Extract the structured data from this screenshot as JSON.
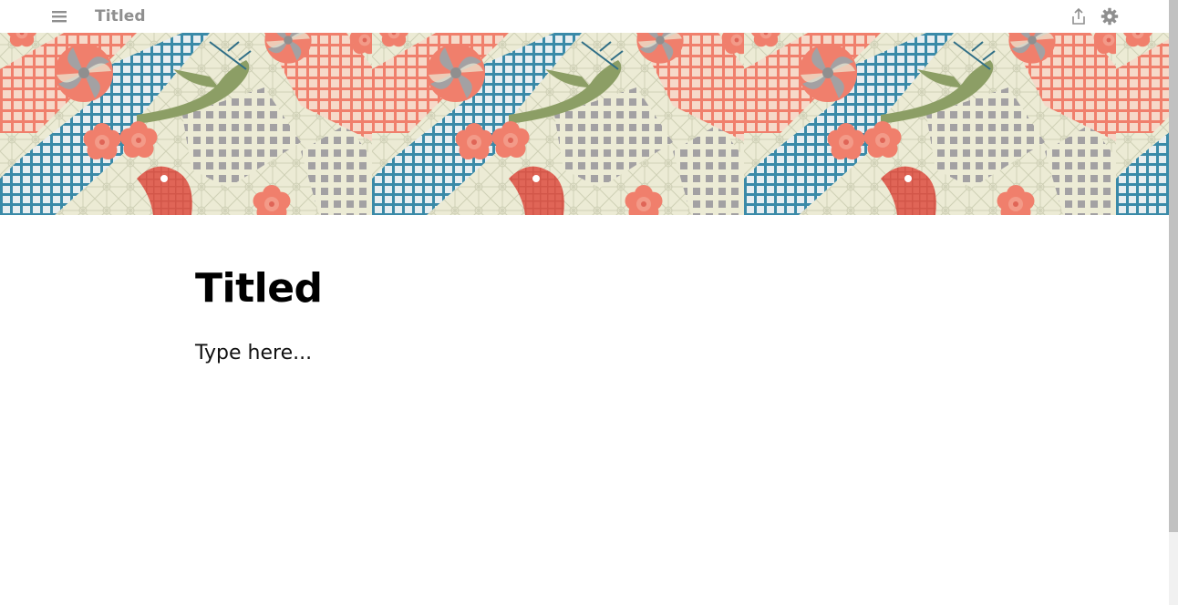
{
  "header": {
    "title": "Titled",
    "icons": {
      "menu": "hamburger-menu-icon",
      "share": "share-icon",
      "settings": "gear-icon"
    }
  },
  "banner": {
    "pattern": "japanese-patchwork-birds-flowers",
    "colors": {
      "cream": "#ecebd5",
      "salmon": "#f07f6c",
      "teal": "#3a8aa8",
      "olive": "#8c9e65",
      "gray": "#a3a1a3",
      "coral": "#e06557"
    }
  },
  "document": {
    "heading": "Titled",
    "body": "Type here..."
  },
  "colors": {
    "icon": "#8f8f8f",
    "text": "#000000"
  }
}
